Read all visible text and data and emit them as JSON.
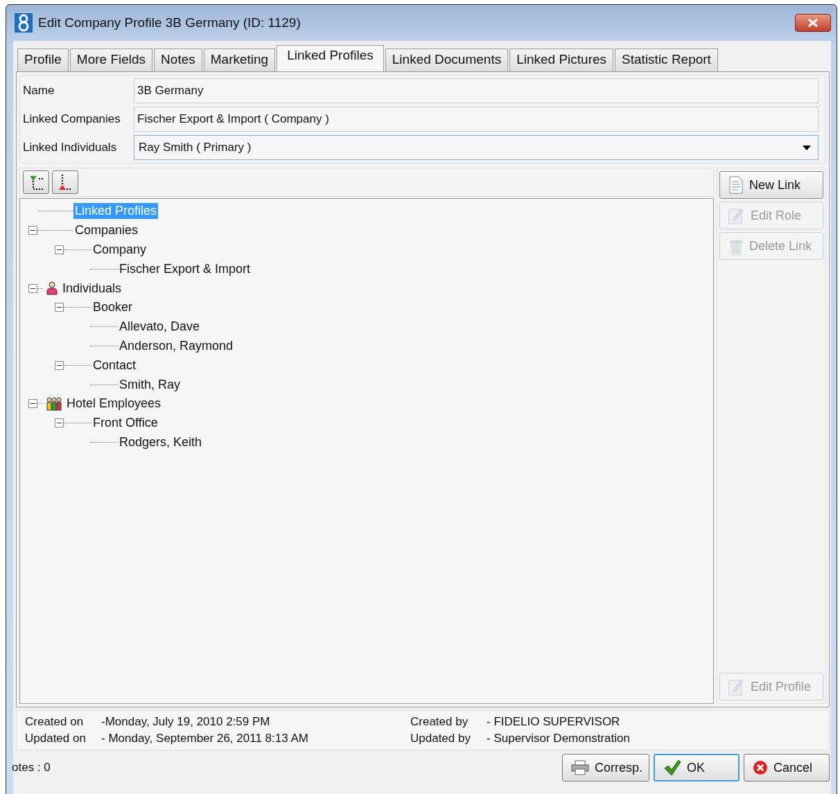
{
  "window": {
    "title": "Edit Company Profile 3B Germany (ID: 1129)"
  },
  "tabs": [
    {
      "label": "Profile",
      "selected": false
    },
    {
      "label": "More Fields",
      "selected": false
    },
    {
      "label": "Notes",
      "selected": false
    },
    {
      "label": "Marketing",
      "selected": false
    },
    {
      "label": "Linked Profiles",
      "selected": true
    },
    {
      "label": "Linked Documents",
      "selected": false
    },
    {
      "label": "Linked Pictures",
      "selected": false
    },
    {
      "label": "Statistic Report",
      "selected": false
    }
  ],
  "fields": [
    {
      "label": "Name",
      "value": "3B Germany",
      "kind": "text"
    },
    {
      "label": "Linked Companies",
      "value": "Fischer Export & Import ( Company )",
      "kind": "text"
    },
    {
      "label": "Linked Individuals",
      "value": "Ray Smith ( Primary )",
      "kind": "dropdown"
    }
  ],
  "tree": [
    {
      "label": "Linked Profiles",
      "selected": true,
      "kind": "plain"
    },
    {
      "label": "Companies",
      "selected": false,
      "kind": "plain",
      "expanded": true,
      "children": [
        {
          "label": "Company",
          "selected": false,
          "kind": "plain",
          "expanded": true,
          "children": [
            {
              "label": "Fischer Export & Import",
              "selected": false,
              "kind": "plain"
            }
          ]
        }
      ]
    },
    {
      "label": "Individuals",
      "selected": false,
      "kind": "person",
      "expanded": true,
      "children": [
        {
          "label": "Booker",
          "selected": false,
          "kind": "plain",
          "expanded": true,
          "children": [
            {
              "label": "Allevato, Dave",
              "selected": false,
              "kind": "plain"
            },
            {
              "label": "Anderson, Raymond",
              "selected": false,
              "kind": "plain"
            }
          ]
        },
        {
          "label": "Contact",
          "selected": false,
          "kind": "plain",
          "expanded": true,
          "children": [
            {
              "label": "Smith, Ray",
              "selected": false,
              "kind": "plain"
            }
          ]
        }
      ]
    },
    {
      "label": "Hotel Employees",
      "selected": false,
      "kind": "group",
      "expanded": true,
      "children": [
        {
          "label": "Front Office",
          "selected": false,
          "kind": "plain",
          "expanded": true,
          "children": [
            {
              "label": "Rodgers, Keith",
              "selected": false,
              "kind": "plain"
            }
          ]
        }
      ]
    }
  ],
  "side_buttons": [
    {
      "label": "New Link",
      "kind": "document",
      "disabled": false
    },
    {
      "label": "Edit Role",
      "kind": "edit",
      "disabled": true
    },
    {
      "label": "Delete Link",
      "kind": "trash",
      "disabled": true
    }
  ],
  "edit_profile_button": {
    "label": "Edit Profile",
    "kind": "edit",
    "disabled": true
  },
  "info": [
    {
      "label": "Created on",
      "value": "-Monday, July 19, 2010 2:59 PM"
    },
    {
      "label": "Created by",
      "value": "- FIDELIO SUPERVISOR"
    },
    {
      "label": "Updated on",
      "value": "- Monday, September 26, 2011 8:13 AM"
    },
    {
      "label": "Updated by",
      "value": "- Supervisor Demonstration"
    }
  ],
  "notes_count": "otes : 0",
  "buttons": [
    {
      "label": "Corresp.",
      "kind": "printer",
      "focused": false
    },
    {
      "label": "OK",
      "kind": "check",
      "focused": true
    },
    {
      "label": "Cancel",
      "kind": "cancel",
      "focused": false
    }
  ]
}
